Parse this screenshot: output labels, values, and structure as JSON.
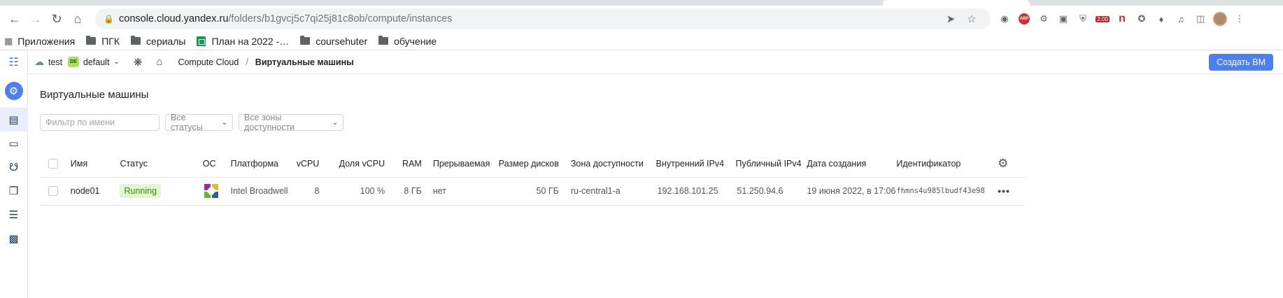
{
  "browser": {
    "url_host": "console.cloud.yandex.ru",
    "url_path": "/folders/b1gvcj5c7qi25j81c8ob/compute/instances",
    "abp_label": "ABP",
    "ext_badge": "2.00",
    "ext_n": "n",
    "bookmarks": [
      "Приложения",
      "ПГК",
      "сериалы",
      "План на 2022 -…",
      "coursehuter",
      "обучение"
    ]
  },
  "topbar": {
    "cloud_name": "test",
    "folder_badge": "DE",
    "folder_name": "default",
    "service": "Compute Cloud",
    "separator": "/",
    "current_page": "Виртуальные машины",
    "create_button": "Создать ВМ"
  },
  "page": {
    "title": "Виртуальные машины",
    "filter_placeholder": "Фильтр по имени",
    "status_filter": "Все статусы",
    "zone_filter": "Все зоны доступности"
  },
  "table": {
    "columns": [
      "Имя",
      "Статус",
      "ОС",
      "Платформа",
      "vCPU",
      "Доля vCPU",
      "RAM",
      "Прерываемая",
      "Размер дисков",
      "Зона доступности",
      "Внутренний IPv4",
      "Публичный IPv4",
      "Дата создания",
      "Идентификатор"
    ],
    "rows": [
      {
        "name": "node01",
        "status": "Running",
        "platform": "Intel Broadwell",
        "vcpu": "8",
        "vcpu_share": "100 %",
        "ram": "8 ГБ",
        "preemptible": "нет",
        "disk_size": "50 ГБ",
        "zone": "ru-central1-a",
        "internal_ip": "192.168.101.25",
        "public_ip": "51.250.94.6",
        "created": "19 июня 2022, в 17:06",
        "id": "fhmns4u985lbudf43e98"
      }
    ]
  }
}
